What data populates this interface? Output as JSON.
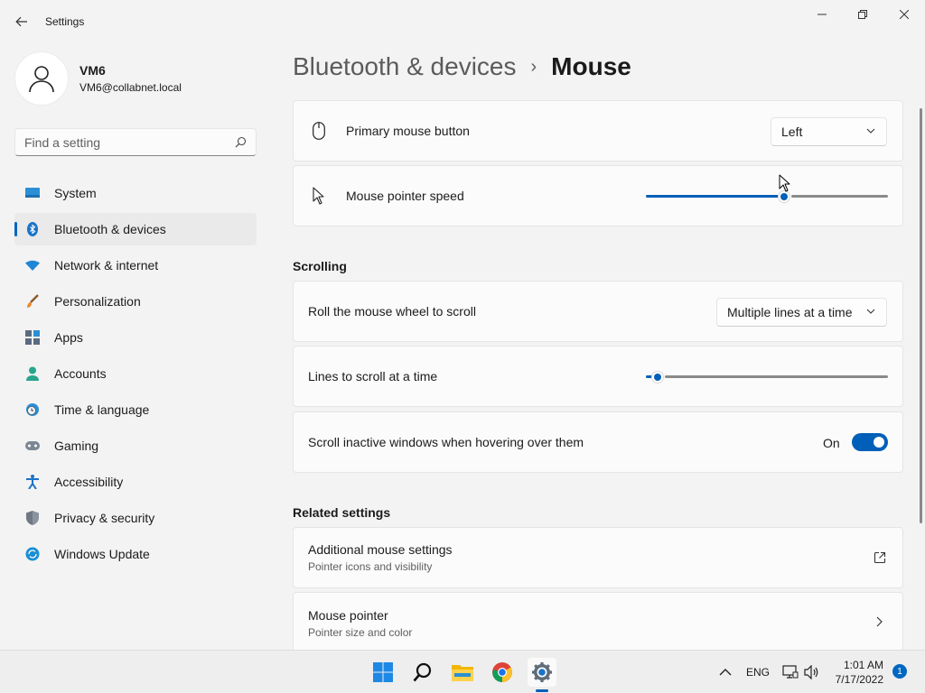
{
  "window": {
    "title": "Settings"
  },
  "profile": {
    "name": "VM6",
    "email": "VM6@collabnet.local"
  },
  "search": {
    "placeholder": "Find a setting"
  },
  "sidebar": {
    "items": [
      {
        "label": "System",
        "icon": "monitor-icon"
      },
      {
        "label": "Bluetooth & devices",
        "icon": "bluetooth-icon",
        "active": true
      },
      {
        "label": "Network & internet",
        "icon": "wifi-icon"
      },
      {
        "label": "Personalization",
        "icon": "brush-icon"
      },
      {
        "label": "Apps",
        "icon": "apps-icon"
      },
      {
        "label": "Accounts",
        "icon": "person-icon"
      },
      {
        "label": "Time & language",
        "icon": "clock-globe-icon"
      },
      {
        "label": "Gaming",
        "icon": "gamepad-icon"
      },
      {
        "label": "Accessibility",
        "icon": "accessibility-icon"
      },
      {
        "label": "Privacy & security",
        "icon": "shield-icon"
      },
      {
        "label": "Windows Update",
        "icon": "update-icon"
      }
    ]
  },
  "breadcrumb": {
    "parent": "Bluetooth & devices",
    "separator": "›",
    "current": "Mouse"
  },
  "settings": {
    "primary_button": {
      "label": "Primary mouse button",
      "value": "Left"
    },
    "pointer_speed": {
      "label": "Mouse pointer speed",
      "level": 0.57
    },
    "scrolling_title": "Scrolling",
    "roll_wheel": {
      "label": "Roll the mouse wheel to scroll",
      "value": "Multiple lines at a time"
    },
    "lines_to_scroll": {
      "label": "Lines to scroll at a time",
      "level": 0.05
    },
    "scroll_inactive": {
      "label": "Scroll inactive windows when hovering over them",
      "state": "On",
      "enabled": true
    },
    "related_title": "Related settings",
    "additional_mouse": {
      "label": "Additional mouse settings",
      "sub": "Pointer icons and visibility"
    },
    "mouse_pointer": {
      "label": "Mouse pointer",
      "sub": "Pointer size and color"
    }
  },
  "taskbar": {
    "apps": [
      "start-icon",
      "search-icon",
      "file-explorer-icon",
      "chrome-icon",
      "settings-icon"
    ],
    "language": "ENG",
    "time": "1:01 AM",
    "date": "7/17/2022",
    "notifications": "1"
  },
  "colors": {
    "accent": "#005fb8",
    "background": "#f3f3f3",
    "card": "#fbfbfb"
  }
}
